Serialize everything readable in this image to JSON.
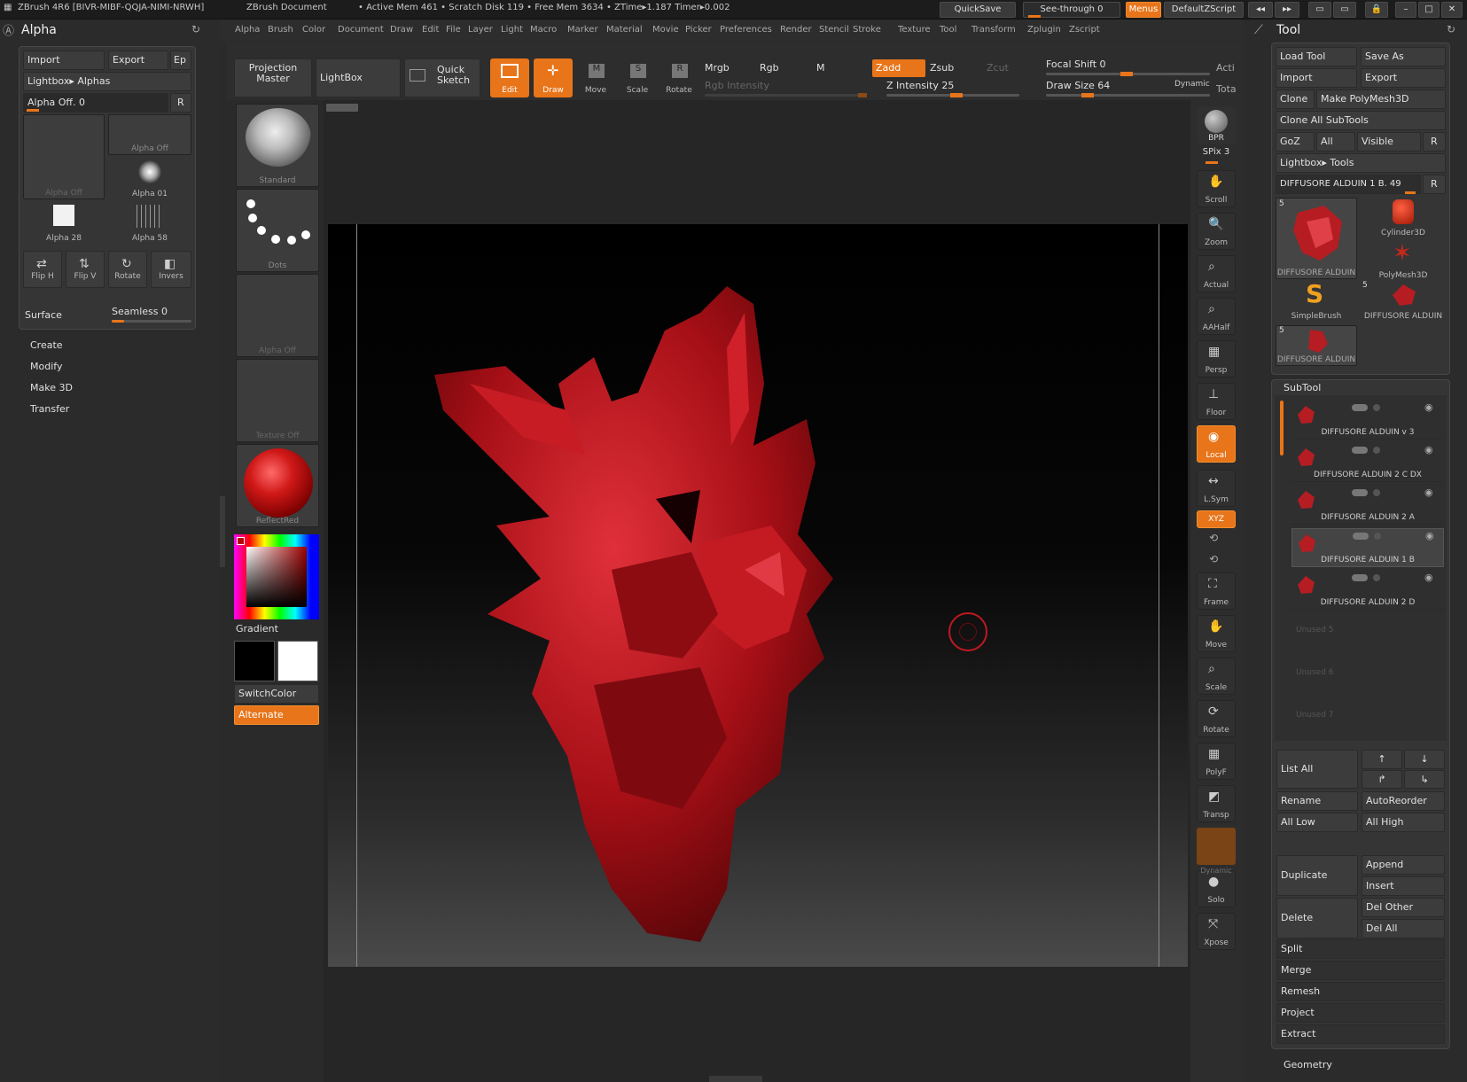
{
  "titlebar": {
    "app": "ZBrush 4R6 [BIVR-MIBF-QQJA-NIMI-NRWH]",
    "doc": "ZBrush Document",
    "stats": "• Active Mem 461 • Scratch Disk 119 • Free Mem 3634 • ZTime▸1.187 Timer▸0.002",
    "quicksave": "QuickSave",
    "seethrough": "See-through  0",
    "menus": "Menus",
    "script": "DefaultZScript"
  },
  "menus": [
    "Alpha",
    "Brush",
    "Color",
    "Document",
    "Draw",
    "Edit",
    "File",
    "Layer",
    "Light",
    "Macro",
    "Marker",
    "Material",
    "Movie",
    "Picker",
    "Preferences",
    "Render",
    "Stencil",
    "Stroke",
    "Texture",
    "Tool",
    "Transform",
    "Zplugin",
    "Zscript"
  ],
  "alpha_panel": {
    "title": "Alpha",
    "import": "Import",
    "export": "Export",
    "ep": "Ep",
    "lightbox": "Lightbox▸ Alphas",
    "alpha_off": "Alpha Off. 0",
    "r": "R",
    "thumbs": [
      "Alpha Off",
      "Alpha Off",
      "Alpha 01",
      "Alpha 28",
      "Alpha 58"
    ],
    "tools": [
      "Flip H",
      "Flip V",
      "Rotate",
      "Invers"
    ],
    "surface": "Surface",
    "seamless": "Seamless 0",
    "sections": [
      "Create",
      "Modify",
      "Make 3D",
      "Transfer"
    ]
  },
  "toolbar": {
    "projection_master": "Projection Master",
    "lightbox": "LightBox",
    "quick_sketch": "Quick Sketch",
    "edit": "Edit",
    "draw": "Draw",
    "move": "Move",
    "scale": "Scale",
    "rotate": "Rotate",
    "mrgb": "Mrgb",
    "rgb": "Rgb",
    "m": "M",
    "zadd": "Zadd",
    "zsub": "Zsub",
    "zcut": "Zcut",
    "rgb_intensity": "Rgb Intensity",
    "z_intensity": "Z Intensity 25",
    "focal_shift": "Focal Shift 0",
    "draw_size": "Draw Size 64",
    "dynamic": "Dynamic",
    "acti": "Acti",
    "tota": "Tota"
  },
  "left_shelf": {
    "brush": "Standard",
    "stroke": "Dots",
    "alpha": "Alpha Off",
    "texture": "Texture Off",
    "material": "ReflectRed",
    "gradient": "Gradient",
    "switchcolor": "SwitchColor",
    "alternate": "Alternate"
  },
  "right_shelf": {
    "bpr": "BPR",
    "spix": "SPix 3",
    "items": [
      "Scroll",
      "Zoom",
      "Actual",
      "AAHalf",
      "Persp",
      "Floor",
      "Local",
      "L.Sym",
      "XYZ",
      "Frame",
      "Move",
      "Scale",
      "Rotate",
      "PolyF",
      "Transp",
      "Solo",
      "Xpose"
    ],
    "dynamic": "Dynamic"
  },
  "tool_panel": {
    "title": "Tool",
    "load_tool": "Load Tool",
    "save_as": "Save As",
    "import": "Import",
    "export": "Export",
    "clone": "Clone",
    "make_polymesh": "Make PolyMesh3D",
    "clone_all": "Clone All SubTools",
    "goz": "GoZ",
    "all": "All",
    "visible": "Visible",
    "r": "R",
    "lightbox_tools": "Lightbox▸ Tools",
    "current_tool": "DIFFUSORE ALDUIN 1 B. 49",
    "tool_thumbs": [
      "DIFFUSORE ALDUIN",
      "Cylinder3D",
      "PolyMesh3D",
      "SimpleBrush",
      "DIFFUSORE ALDUIN",
      "DIFFUSORE ALDUIN"
    ],
    "thumb_counts": [
      "5",
      "5",
      "5"
    ],
    "subtool_header": "SubTool",
    "subtools": [
      "DIFFUSORE ALDUIN v 3",
      "DIFFUSORE ALDUIN 2 C DX",
      "DIFFUSORE ALDUIN 2 A",
      "DIFFUSORE ALDUIN 1 B",
      "DIFFUSORE ALDUIN 2 D"
    ],
    "unused": [
      "Unused 5",
      "Unused 6",
      "Unused 7"
    ],
    "list_all": "List All",
    "rename": "Rename",
    "autoreorder": "AutoReorder",
    "all_low": "All Low",
    "all_high": "All High",
    "duplicate": "Duplicate",
    "append": "Append",
    "insert": "Insert",
    "delete": "Delete",
    "del_other": "Del Other",
    "del_all": "Del All",
    "split": "Split",
    "merge": "Merge",
    "remesh": "Remesh",
    "project": "Project",
    "extract": "Extract",
    "geometry": "Geometry"
  },
  "colors": {
    "accent": "#e8751a",
    "model": "#b0141c",
    "canvas_bg": "#050505"
  }
}
